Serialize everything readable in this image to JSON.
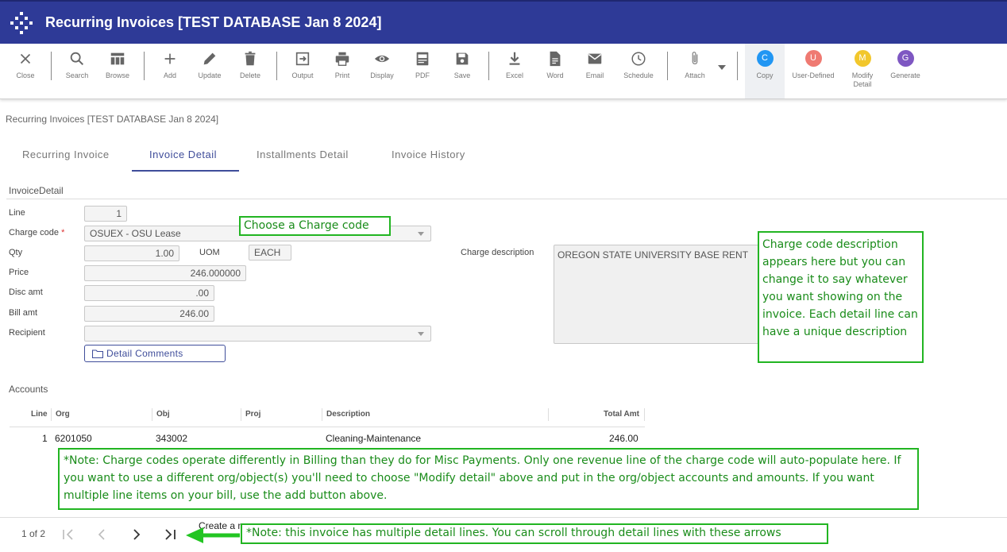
{
  "app": {
    "title": "Recurring Invoices [TEST DATABASE Jan 8 2024]"
  },
  "toolbar": {
    "buttons": [
      {
        "label": "Close",
        "icon": "close-icon"
      },
      {
        "label": "Search",
        "icon": "search-icon"
      },
      {
        "label": "Browse",
        "icon": "table-icon"
      },
      {
        "label": "Add",
        "icon": "plus-icon"
      },
      {
        "label": "Update",
        "icon": "pencil-icon"
      },
      {
        "label": "Delete",
        "icon": "trash-icon"
      },
      {
        "label": "Output",
        "icon": "output-icon"
      },
      {
        "label": "Print",
        "icon": "printer-icon"
      },
      {
        "label": "Display",
        "icon": "eye-icon"
      },
      {
        "label": "PDF",
        "icon": "pdf-icon"
      },
      {
        "label": "Save",
        "icon": "floppy-icon"
      },
      {
        "label": "Excel",
        "icon": "download-icon"
      },
      {
        "label": "Word",
        "icon": "document-icon"
      },
      {
        "label": "Email",
        "icon": "envelope-icon"
      },
      {
        "label": "Schedule",
        "icon": "clock-icon"
      },
      {
        "label": "Attach",
        "icon": "paperclip-icon"
      }
    ],
    "circles": [
      {
        "letter": "C",
        "label": "Copy",
        "color": "#2196f3"
      },
      {
        "letter": "U",
        "label": "User-Defined",
        "color": "#ef7a72"
      },
      {
        "letter": "M",
        "label": "Modify Detail",
        "label_line1": "Modify",
        "label_line2": "Detail",
        "color": "#f2c72c"
      },
      {
        "letter": "G",
        "label": "Generate",
        "color": "#7e57c2"
      }
    ]
  },
  "breadcrumb": "Recurring Invoices [TEST DATABASE Jan 8 2024]",
  "tabs": [
    {
      "label": "Recurring Invoice",
      "active": false
    },
    {
      "label": "Invoice Detail",
      "active": true
    },
    {
      "label": "Installments Detail",
      "active": false
    },
    {
      "label": "Invoice History",
      "active": false
    }
  ],
  "invoice_detail": {
    "section_title": "InvoiceDetail",
    "line_label": "Line",
    "line_value": "1",
    "charge_code_label": "Charge code",
    "required_mark": "*",
    "charge_code_value": "OSUEX - OSU Lease",
    "qty_label": "Qty",
    "qty_value": "1.00",
    "uom_label": "UOM",
    "uom_value": "EACH",
    "price_label": "Price",
    "price_value": "246.000000",
    "disc_label": "Disc amt",
    "disc_value": ".00",
    "bill_label": "Bill amt",
    "bill_value": "246.00",
    "recipient_label": "Recipient",
    "recipient_value": "",
    "detail_comments_label": "Detail Comments",
    "charge_desc_label": "Charge description",
    "charge_desc_value": "OREGON STATE UNIVERSITY BASE RENT"
  },
  "accounts": {
    "section_title": "Accounts",
    "headers": {
      "line": "Line",
      "org": "Org",
      "obj": "Obj",
      "proj": "Proj",
      "description": "Description",
      "total": "Total Amt"
    },
    "rows": [
      {
        "line": "1",
        "org": "6201050",
        "obj": "343002",
        "proj": "",
        "description": "Cleaning-Maintenance",
        "total": "246.00"
      }
    ]
  },
  "pager": {
    "text": "1 of 2",
    "create_text": "Create a n"
  },
  "callouts": {
    "charge_code": "Choose a Charge code",
    "description": "Charge code description appears here but you can change it to say whatever you want showing on the invoice. Each detail line can have a unique description",
    "note_billing": "*Note: Charge codes operate differently in Billing than they do for Misc Payments. Only one revenue line of the charge code will auto-populate here. If you want to use a different org/object(s) you'll need to choose \"Modify detail\" above and put in the org/object accounts and amounts. If you want multiple line items on your bill, use the add button above.",
    "note_lines": "*Note: this invoice has multiple detail lines. You can scroll through detail lines with these arrows"
  },
  "colors": {
    "header": "#2e3a97",
    "accent": "#3f4d9a",
    "callout": "#22b522"
  }
}
